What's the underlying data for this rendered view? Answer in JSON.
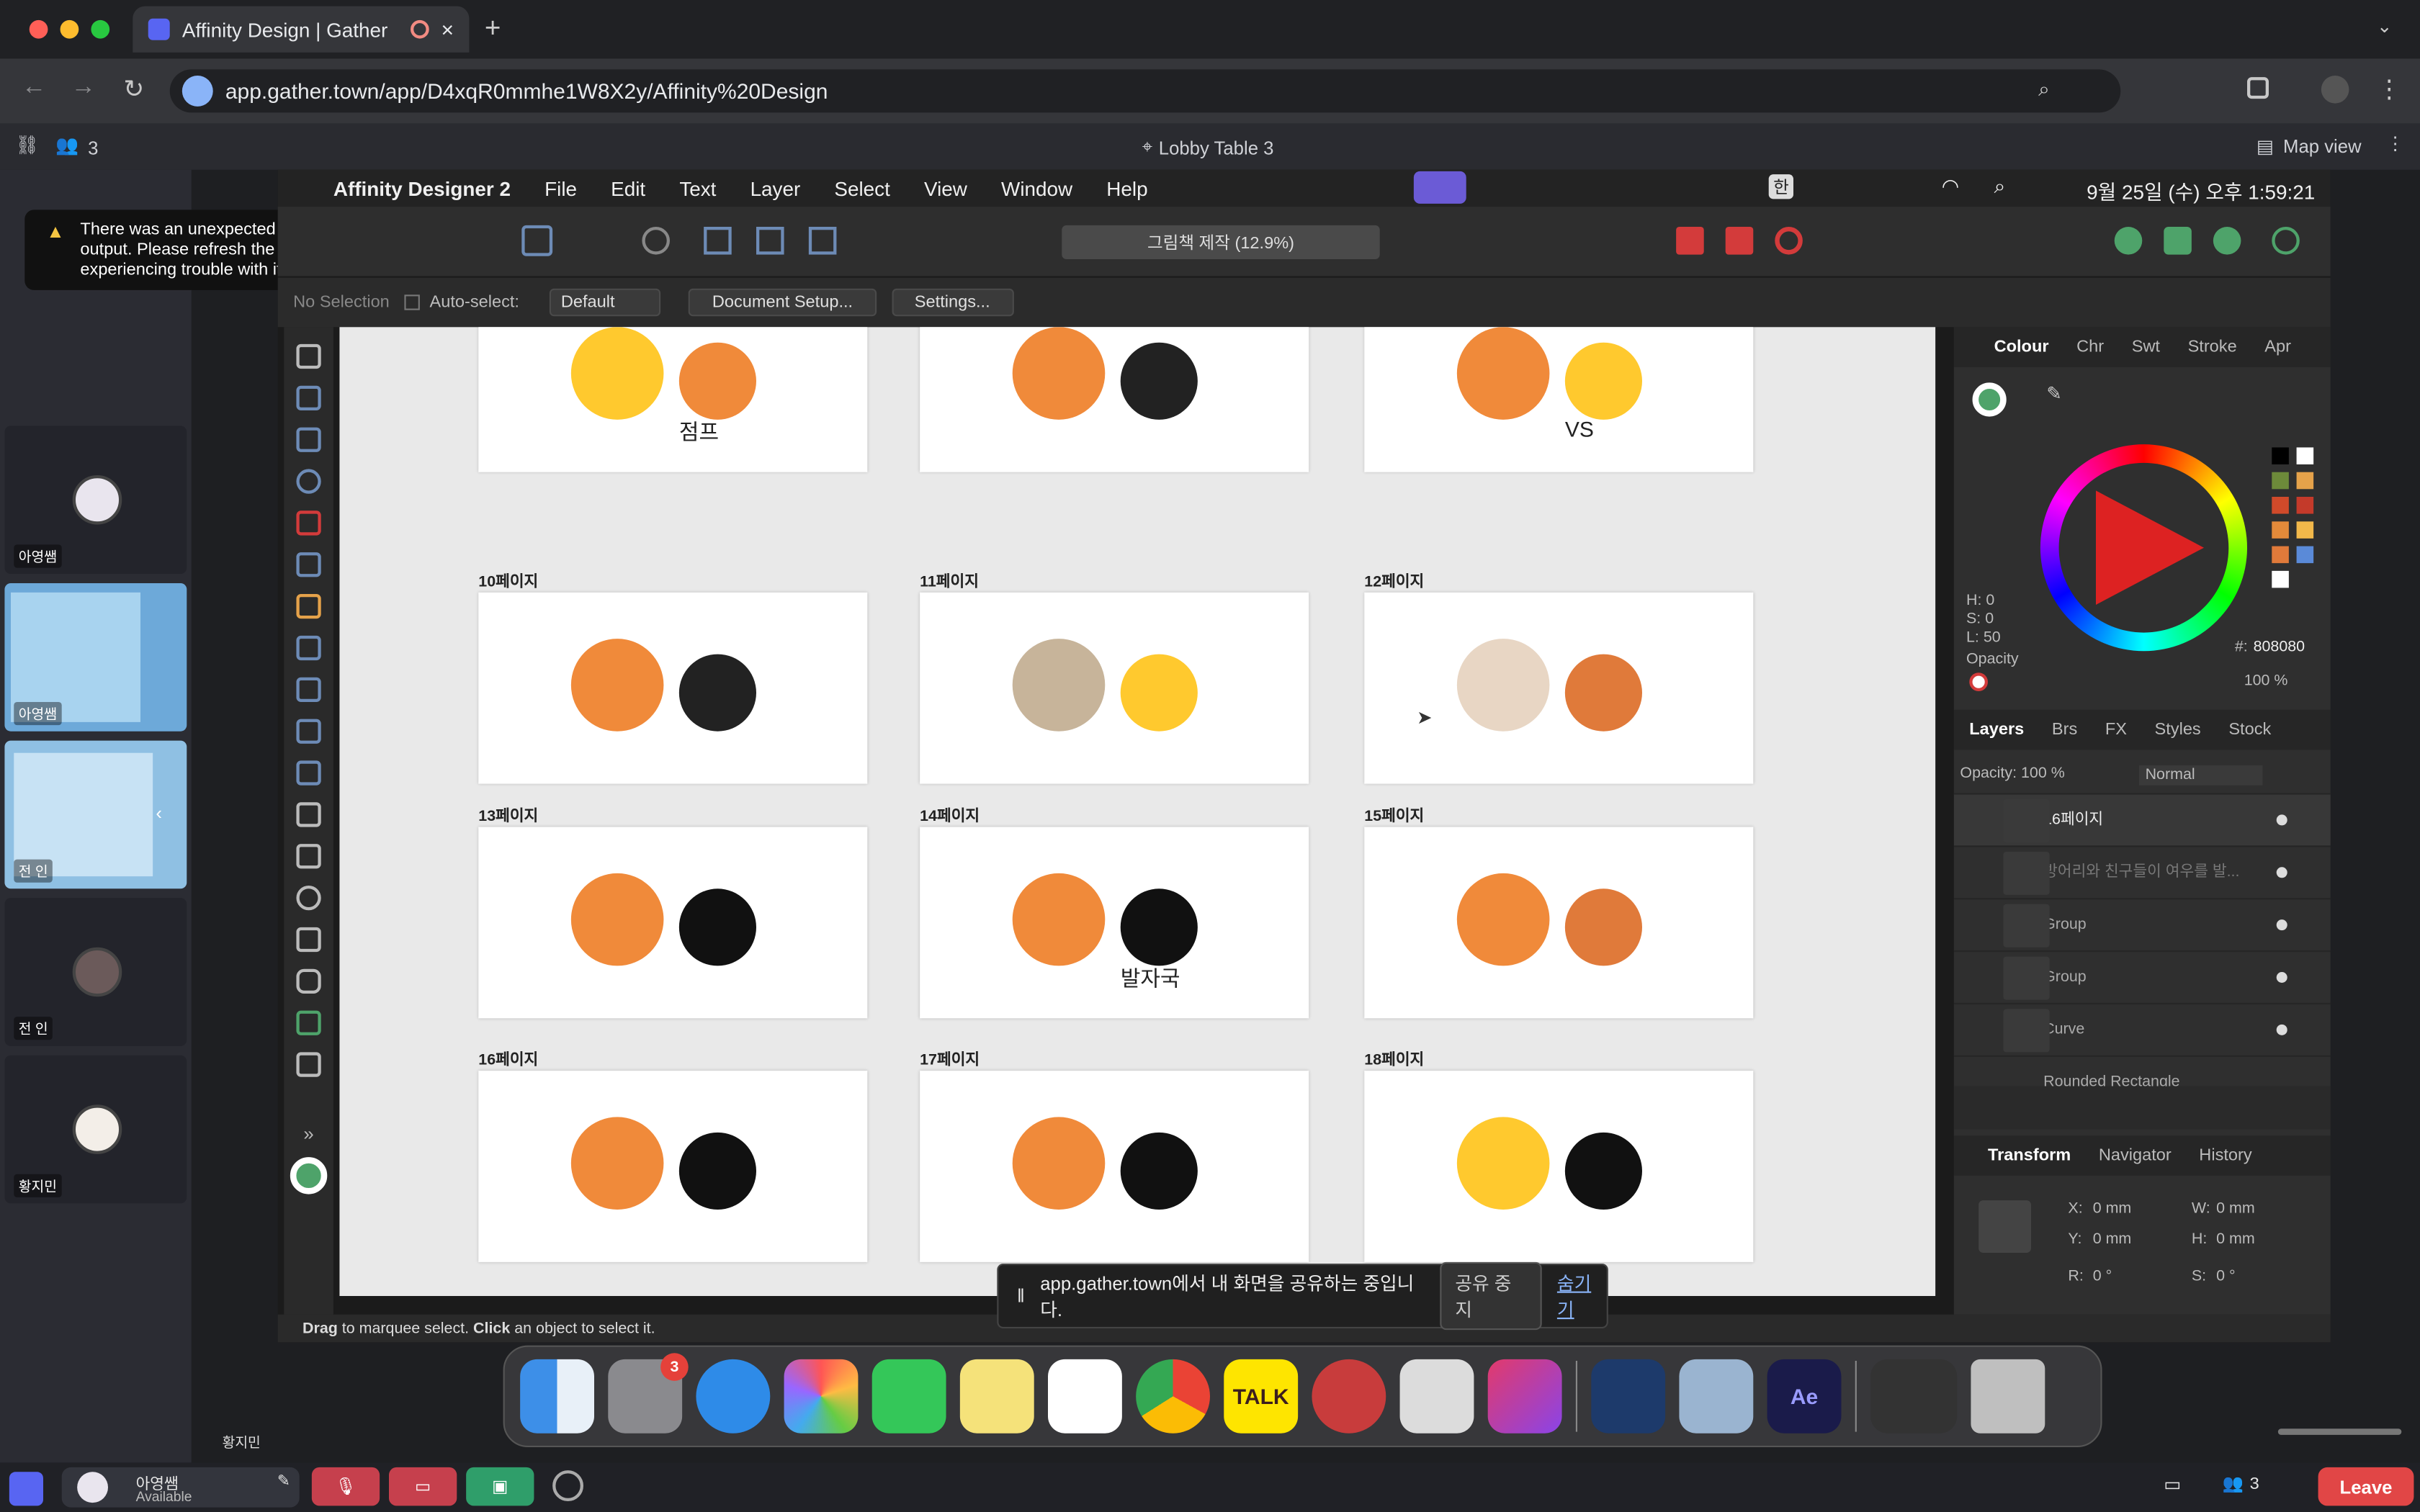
{
  "browser": {
    "tab_title": "Affinity Design | Gather",
    "url": "app.gather.town/app/D4xqR0mmhe1W8X2y/Affinity%20Design"
  },
  "gather": {
    "participant_count": "3",
    "location": "Lobby Table 3",
    "map_view": "Map view",
    "error_toast": "There was an unexpected error with your sound output. Please refresh the page if you are experiencing trouble with it.",
    "participants": [
      {
        "name": "아영쌤"
      },
      {
        "name": "아영쌤"
      },
      {
        "name": "전 인"
      },
      {
        "name": "전 인"
      },
      {
        "name": "황지민"
      }
    ],
    "bottom_name": "황지민",
    "user": {
      "name": "아영쌤",
      "status": "Available"
    },
    "bottom_count": "3",
    "leave": "Leave"
  },
  "mac": {
    "app_name": "Affinity Designer 2",
    "menu": [
      "File",
      "Edit",
      "Text",
      "Layer",
      "Select",
      "View",
      "Window",
      "Help"
    ],
    "clock": "9월 25일 (수) 오후 1:59:21",
    "ime": "한"
  },
  "affinity": {
    "doc_title": "그림책 제작 (12.9%)",
    "context": {
      "no_selection": "No Selection",
      "auto_select": "Auto-select:",
      "default": "Default",
      "document_setup": "Document Setup...",
      "settings": "Settings..."
    },
    "pages": [
      {
        "label": "",
        "tag": "점프"
      },
      {
        "label": "",
        "tag": ""
      },
      {
        "label": "",
        "tag": "VS"
      },
      {
        "label": "10페이지",
        "tag": ""
      },
      {
        "label": "11페이지",
        "tag": ""
      },
      {
        "label": "12페이지",
        "tag": ""
      },
      {
        "label": "13페이지",
        "tag": ""
      },
      {
        "label": "14페이지",
        "tag": "발자국"
      },
      {
        "label": "15페이지",
        "tag": ""
      },
      {
        "label": "16페이지",
        "tag": ""
      },
      {
        "label": "17페이지",
        "tag": ""
      },
      {
        "label": "18페이지",
        "tag": ""
      }
    ],
    "colour_tabs": [
      "Colour",
      "Chr",
      "Swt",
      "Stroke",
      "Apr"
    ],
    "hsl": {
      "h": "H: 0",
      "s": "S: 0",
      "l": "L: 50"
    },
    "hex_label": "#:",
    "hex": "808080",
    "opacity_label": "Opacity",
    "opacity_value": "100 %",
    "layers_tabs": [
      "Layers",
      "Brs",
      "FX",
      "Styles",
      "Stock"
    ],
    "layers_opacity": "Opacity: 100 %",
    "blend": "Normal",
    "layers": [
      "16페이지",
      "방어리와 친구들이 여우를 발...",
      "Group",
      "Group",
      "Curve",
      "Rounded Rectangle"
    ],
    "transform_tabs": [
      "Transform",
      "Navigator",
      "History"
    ],
    "transform": {
      "x": "X:",
      "x_val": "0 mm",
      "y": "Y:",
      "y_val": "0 mm",
      "w": "W:",
      "w_val": "0 mm",
      "h": "H:",
      "h_val": "0 mm",
      "r": "R:",
      "r_val": "0 °",
      "s": "S:",
      "s_val": "0 °"
    },
    "status_bold1": "Drag",
    "status_text1": " to marquee select. ",
    "status_bold2": "Click",
    "status_text2": " an object to select it."
  },
  "share_bar": {
    "text": "app.gather.town에서 내 화면을 공유하는 중입니다.",
    "stop": "공유 중지",
    "hide": "숨기기"
  },
  "dock": {
    "settings_badge": "3",
    "talk": "TALK",
    "ae": "Ae"
  },
  "colors": {
    "accent": "#6d8bb6",
    "leave": "#e14646",
    "hex": "#808080"
  }
}
